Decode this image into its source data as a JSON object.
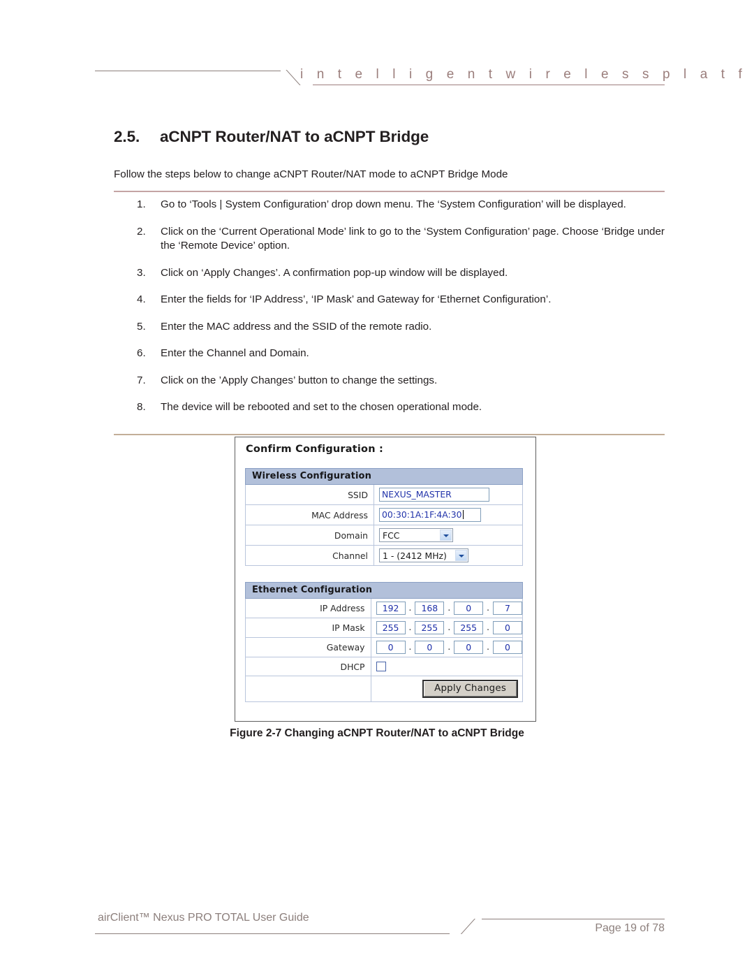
{
  "header": {
    "tagline": "i n t e l l i g e n t     w i r e l e s s     p l a t f o r m",
    "rule_color": "#8c7f7c",
    "text_color": "#9b7e7c"
  },
  "section": {
    "number": "2.5.",
    "title": "aCNPT Router/NAT to aCNPT Bridge",
    "intro": "Follow the steps below to change aCNPT Router/NAT mode to aCNPT Bridge Mode"
  },
  "steps": [
    {
      "num": "1.",
      "text": "Go to ‘Tools | System Configuration’ drop down menu. The ‘System Configuration’ will be displayed."
    },
    {
      "num": "2.",
      "text": "Click on the ‘Current Operational Mode’ link to go to the ‘System Configuration’ page. Choose ‘Bridge under the ‘Remote Device’ option."
    },
    {
      "num": "3.",
      "text": "Click on ‘Apply Changes’. A confirmation pop-up window will be displayed."
    },
    {
      "num": "4.",
      "text": "Enter the fields for ‘IP Address’, ‘IP Mask’ and Gateway for ‘Ethernet Configuration’."
    },
    {
      "num": "5.",
      "text": "Enter the MAC address and the SSID of the remote radio."
    },
    {
      "num": "6.",
      "text": "Enter the Channel and Domain."
    },
    {
      "num": "7.",
      "text": "Click on the ’Apply Changes’ button to change the settings."
    },
    {
      "num": "8.",
      "text": "The device will be rebooted and set to the chosen operational mode."
    }
  ],
  "figure": {
    "confirm_title": "Confirm Configuration :",
    "caption": "Figure 2-7 Changing aCNPT Router/NAT to aCNPT Bridge",
    "wireless": {
      "header": "Wireless Configuration",
      "rows": {
        "ssid_label": "SSID",
        "ssid_value": "NEXUS_MASTER",
        "mac_label": "MAC Address",
        "mac_value": "00:30:1A:1F:4A:30",
        "domain_label": "Domain",
        "domain_value": "FCC",
        "channel_label": "Channel",
        "channel_value": "1 - (2412 MHz)"
      }
    },
    "ethernet": {
      "header": "Ethernet Configuration",
      "rows": {
        "ip_label": "IP Address",
        "ip_octets": [
          "192",
          "168",
          "0",
          "7"
        ],
        "mask_label": "IP Mask",
        "mask_octets": [
          "255",
          "255",
          "255",
          "0"
        ],
        "gateway_label": "Gateway",
        "gateway_octets": [
          "0",
          "0",
          "0",
          "0"
        ],
        "dhcp_label": "DHCP",
        "dhcp_checked": false
      },
      "apply_button": "Apply Changes"
    },
    "header_bar_color": "#b2c0da",
    "input_text_color": "#2233aa",
    "separator": "."
  },
  "footer": {
    "guide": "airClient™ Nexus PRO TOTAL User Guide",
    "page": "Page 19 of 78"
  }
}
